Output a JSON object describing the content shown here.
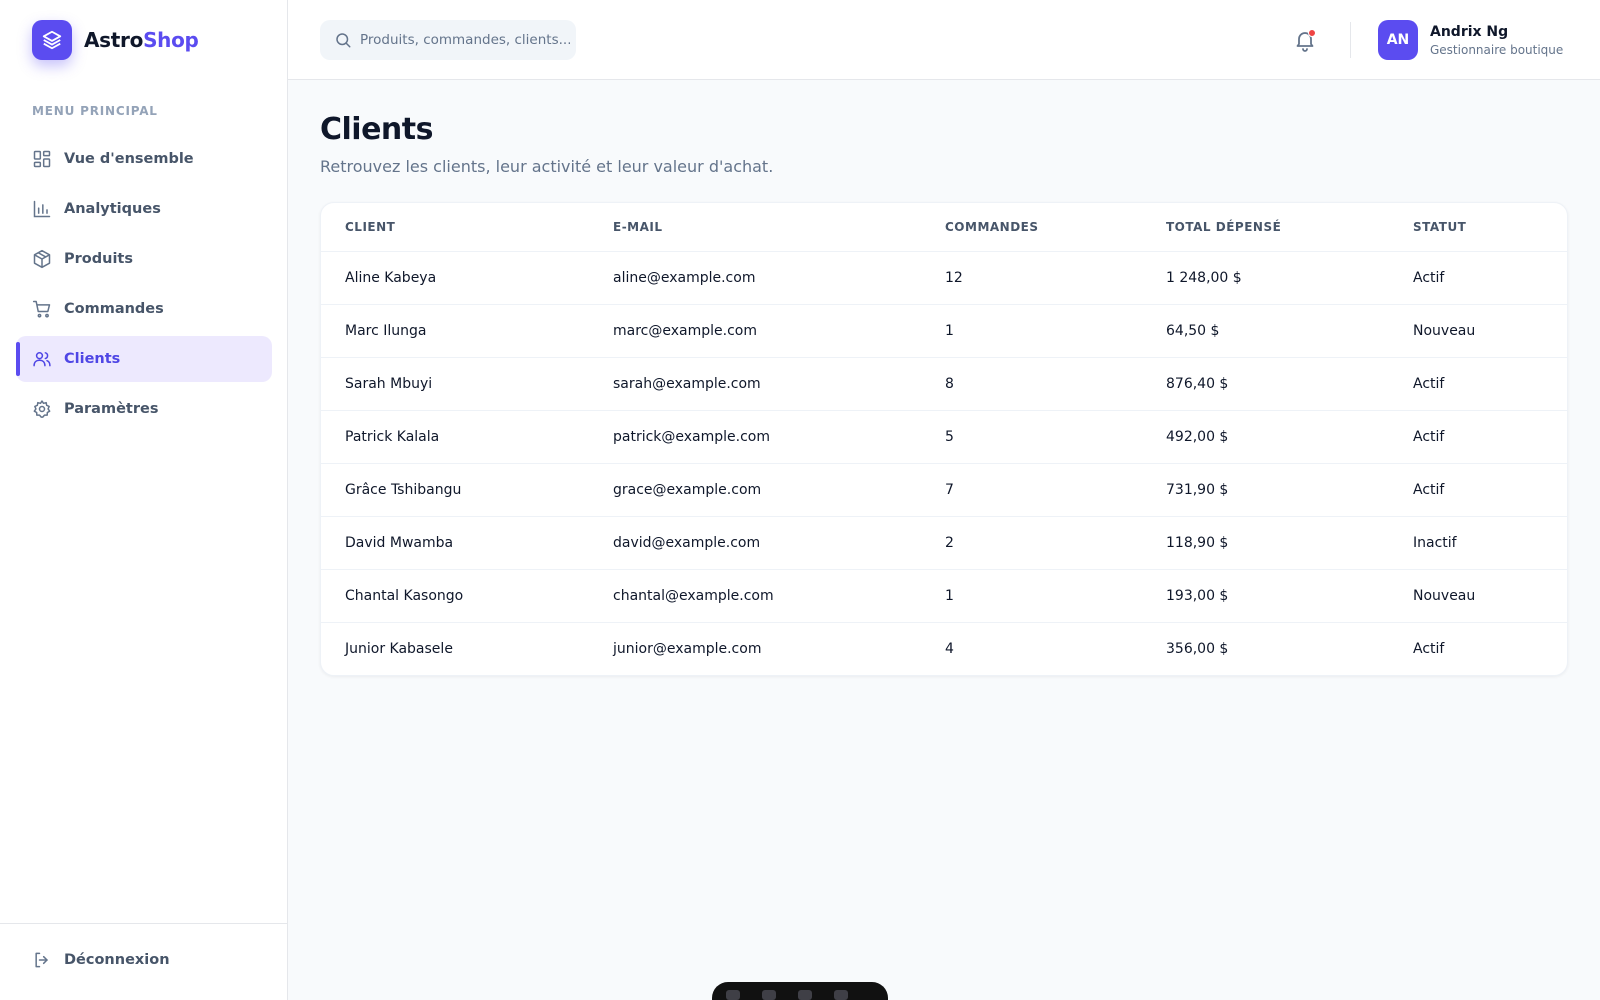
{
  "brand": {
    "part1": "Astro",
    "part2": "Shop"
  },
  "sidebar": {
    "menu_title": "MENU PRINCIPAL",
    "items": [
      {
        "label": "Vue d'ensemble",
        "icon": "grid-icon"
      },
      {
        "label": "Analytiques",
        "icon": "bar-chart-icon"
      },
      {
        "label": "Produits",
        "icon": "box-icon"
      },
      {
        "label": "Commandes",
        "icon": "cart-icon"
      },
      {
        "label": "Clients",
        "icon": "users-icon",
        "active": true
      },
      {
        "label": "Paramètres",
        "icon": "gear-icon"
      }
    ],
    "logout_label": "Déconnexion"
  },
  "topbar": {
    "search_placeholder": "Produits, commandes, clients...",
    "user": {
      "initials": "AN",
      "name": "Andrix Ng",
      "role": "Gestionnaire boutique"
    }
  },
  "page": {
    "title": "Clients",
    "subtitle": "Retrouvez les clients, leur activité et leur valeur d'achat."
  },
  "table": {
    "headers": [
      "CLIENT",
      "E-MAIL",
      "COMMANDES",
      "TOTAL DÉPENSÉ",
      "STATUT"
    ],
    "rows": [
      [
        "Aline Kabeya",
        "aline@example.com",
        "12",
        "1 248,00 $",
        "Actif"
      ],
      [
        "Marc Ilunga",
        "marc@example.com",
        "1",
        "64,50 $",
        "Nouveau"
      ],
      [
        "Sarah Mbuyi",
        "sarah@example.com",
        "8",
        "876,40 $",
        "Actif"
      ],
      [
        "Patrick Kalala",
        "patrick@example.com",
        "5",
        "492,00 $",
        "Actif"
      ],
      [
        "Grâce Tshibangu",
        "grace@example.com",
        "7",
        "731,90 $",
        "Actif"
      ],
      [
        "David Mwamba",
        "david@example.com",
        "2",
        "118,90 $",
        "Inactif"
      ],
      [
        "Chantal Kasongo",
        "chantal@example.com",
        "1",
        "193,00 $",
        "Nouveau"
      ],
      [
        "Junior Kabasele",
        "junior@example.com",
        "4",
        "356,00 $",
        "Actif"
      ]
    ]
  },
  "colors": {
    "accent": "#5b4cf0",
    "accent_soft": "#ede9fe",
    "notification": "#ef4444"
  }
}
